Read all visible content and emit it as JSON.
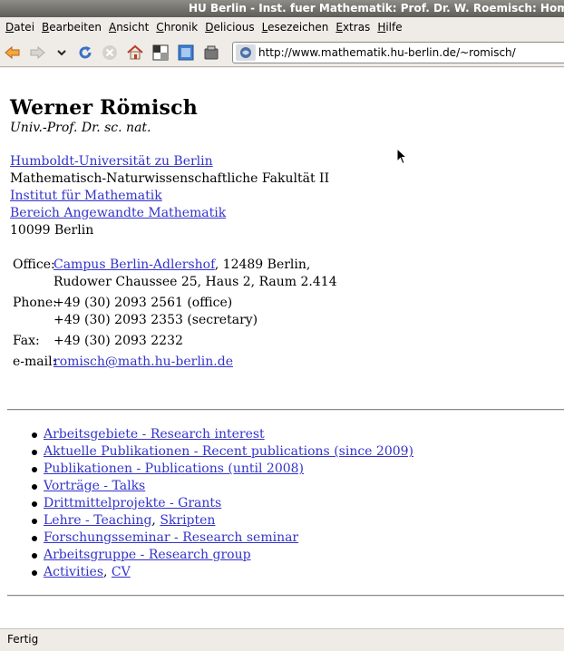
{
  "window": {
    "title": "HU Berlin - Inst. fuer Mathematik: Prof. Dr. W. Roemisch: Homepage"
  },
  "menu": [
    {
      "accel": "D",
      "rest": "atei"
    },
    {
      "accel": "B",
      "rest": "earbeiten"
    },
    {
      "accel": "A",
      "rest": "nsicht"
    },
    {
      "accel": "C",
      "rest": "hronik"
    },
    {
      "accel": "D",
      "rest": "elicious"
    },
    {
      "accel": "L",
      "rest": "esezeichen"
    },
    {
      "accel": "E",
      "rest": "xtras"
    },
    {
      "accel": "H",
      "rest": "ilfe"
    }
  ],
  "toolbar": {
    "icons": [
      "back-icon",
      "forward-icon",
      "history-dropdown-icon",
      "reload-icon",
      "stop-icon",
      "home-icon",
      "toolbar-icon-1",
      "toolbar-icon-2",
      "toolbar-icon-3"
    ],
    "url": "http://www.mathematik.hu-berlin.de/~romisch/"
  },
  "page": {
    "name": "Werner Römisch",
    "degree": "Univ.-Prof.   Dr. sc. nat.",
    "affiliation": {
      "university": "Humboldt-Universität zu Berlin",
      "faculty": "Mathematisch-Naturwissenschaftliche Fakultät II",
      "institute": "Institut für Mathematik",
      "department": "Bereich Angewandte Mathematik",
      "postcode": "10099 Berlin"
    },
    "contact": {
      "office_label": "Office:",
      "office_link": "Campus Berlin-Adlershof",
      "office_rest": ", 12489 Berlin,",
      "office_line2": "Rudower Chaussee 25, Haus 2, Raum 2.414",
      "phone_label": "Phone:",
      "phone_1": "+49 (30) 2093 2561 (office)",
      "phone_2": "+49 (30) 2093 2353 (secretary)",
      "fax_label": "Fax:",
      "fax": "+49 (30) 2093 2232",
      "email_label": "e-mail:",
      "email": "romisch@math.hu-berlin.de"
    },
    "links": [
      {
        "text": "Arbeitsgebiete - Research interest"
      },
      {
        "text": "Aktuelle Publikationen - Recent publications (since 2009)"
      },
      {
        "text": "Publikationen - Publications (until 2008)"
      },
      {
        "text": "Vorträge - Talks"
      },
      {
        "text": "Drittmittelprojekte - Grants"
      },
      {
        "text": "Lehre - Teaching",
        "sep": ", ",
        "text2": "Skripten"
      },
      {
        "text": "Forschungsseminar - Research seminar"
      },
      {
        "text": "Arbeitsgruppe - Research group"
      },
      {
        "text": "Activities",
        "sep": ", ",
        "text2": "CV"
      }
    ]
  },
  "status": {
    "text": "Fertig"
  }
}
